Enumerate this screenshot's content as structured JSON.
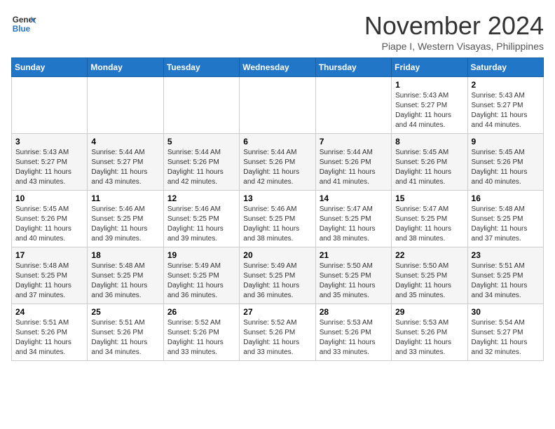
{
  "header": {
    "logo_line1": "General",
    "logo_line2": "Blue",
    "month": "November 2024",
    "location": "Piape I, Western Visayas, Philippines"
  },
  "weekdays": [
    "Sunday",
    "Monday",
    "Tuesday",
    "Wednesday",
    "Thursday",
    "Friday",
    "Saturday"
  ],
  "weeks": [
    [
      null,
      null,
      null,
      null,
      null,
      {
        "day": 1,
        "sunrise": "5:43 AM",
        "sunset": "5:27 PM",
        "daylight": "11 hours and 44 minutes."
      },
      {
        "day": 2,
        "sunrise": "5:43 AM",
        "sunset": "5:27 PM",
        "daylight": "11 hours and 44 minutes."
      }
    ],
    [
      {
        "day": 3,
        "sunrise": "5:43 AM",
        "sunset": "5:27 PM",
        "daylight": "11 hours and 43 minutes."
      },
      {
        "day": 4,
        "sunrise": "5:44 AM",
        "sunset": "5:27 PM",
        "daylight": "11 hours and 43 minutes."
      },
      {
        "day": 5,
        "sunrise": "5:44 AM",
        "sunset": "5:26 PM",
        "daylight": "11 hours and 42 minutes."
      },
      {
        "day": 6,
        "sunrise": "5:44 AM",
        "sunset": "5:26 PM",
        "daylight": "11 hours and 42 minutes."
      },
      {
        "day": 7,
        "sunrise": "5:44 AM",
        "sunset": "5:26 PM",
        "daylight": "11 hours and 41 minutes."
      },
      {
        "day": 8,
        "sunrise": "5:45 AM",
        "sunset": "5:26 PM",
        "daylight": "11 hours and 41 minutes."
      },
      {
        "day": 9,
        "sunrise": "5:45 AM",
        "sunset": "5:26 PM",
        "daylight": "11 hours and 40 minutes."
      }
    ],
    [
      {
        "day": 10,
        "sunrise": "5:45 AM",
        "sunset": "5:26 PM",
        "daylight": "11 hours and 40 minutes."
      },
      {
        "day": 11,
        "sunrise": "5:46 AM",
        "sunset": "5:25 PM",
        "daylight": "11 hours and 39 minutes."
      },
      {
        "day": 12,
        "sunrise": "5:46 AM",
        "sunset": "5:25 PM",
        "daylight": "11 hours and 39 minutes."
      },
      {
        "day": 13,
        "sunrise": "5:46 AM",
        "sunset": "5:25 PM",
        "daylight": "11 hours and 38 minutes."
      },
      {
        "day": 14,
        "sunrise": "5:47 AM",
        "sunset": "5:25 PM",
        "daylight": "11 hours and 38 minutes."
      },
      {
        "day": 15,
        "sunrise": "5:47 AM",
        "sunset": "5:25 PM",
        "daylight": "11 hours and 38 minutes."
      },
      {
        "day": 16,
        "sunrise": "5:48 AM",
        "sunset": "5:25 PM",
        "daylight": "11 hours and 37 minutes."
      }
    ],
    [
      {
        "day": 17,
        "sunrise": "5:48 AM",
        "sunset": "5:25 PM",
        "daylight": "11 hours and 37 minutes."
      },
      {
        "day": 18,
        "sunrise": "5:48 AM",
        "sunset": "5:25 PM",
        "daylight": "11 hours and 36 minutes."
      },
      {
        "day": 19,
        "sunrise": "5:49 AM",
        "sunset": "5:25 PM",
        "daylight": "11 hours and 36 minutes."
      },
      {
        "day": 20,
        "sunrise": "5:49 AM",
        "sunset": "5:25 PM",
        "daylight": "11 hours and 36 minutes."
      },
      {
        "day": 21,
        "sunrise": "5:50 AM",
        "sunset": "5:25 PM",
        "daylight": "11 hours and 35 minutes."
      },
      {
        "day": 22,
        "sunrise": "5:50 AM",
        "sunset": "5:25 PM",
        "daylight": "11 hours and 35 minutes."
      },
      {
        "day": 23,
        "sunrise": "5:51 AM",
        "sunset": "5:25 PM",
        "daylight": "11 hours and 34 minutes."
      }
    ],
    [
      {
        "day": 24,
        "sunrise": "5:51 AM",
        "sunset": "5:26 PM",
        "daylight": "11 hours and 34 minutes."
      },
      {
        "day": 25,
        "sunrise": "5:51 AM",
        "sunset": "5:26 PM",
        "daylight": "11 hours and 34 minutes."
      },
      {
        "day": 26,
        "sunrise": "5:52 AM",
        "sunset": "5:26 PM",
        "daylight": "11 hours and 33 minutes."
      },
      {
        "day": 27,
        "sunrise": "5:52 AM",
        "sunset": "5:26 PM",
        "daylight": "11 hours and 33 minutes."
      },
      {
        "day": 28,
        "sunrise": "5:53 AM",
        "sunset": "5:26 PM",
        "daylight": "11 hours and 33 minutes."
      },
      {
        "day": 29,
        "sunrise": "5:53 AM",
        "sunset": "5:26 PM",
        "daylight": "11 hours and 33 minutes."
      },
      {
        "day": 30,
        "sunrise": "5:54 AM",
        "sunset": "5:27 PM",
        "daylight": "11 hours and 32 minutes."
      }
    ]
  ]
}
